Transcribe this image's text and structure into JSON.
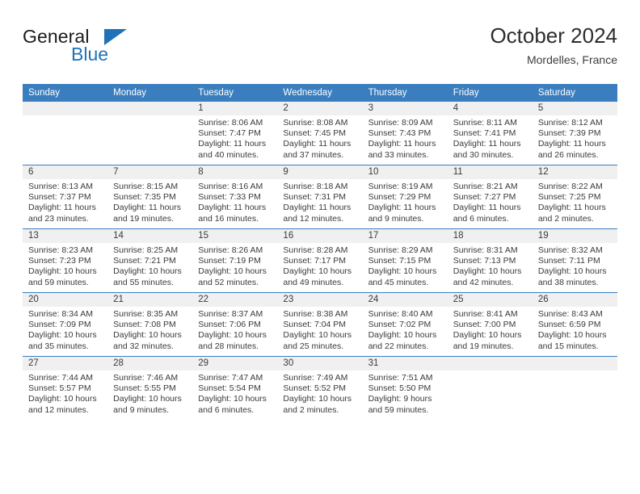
{
  "brand": {
    "name_part1": "General",
    "name_part2": "Blue"
  },
  "header": {
    "title": "October 2024",
    "subtitle": "Mordelles, France"
  },
  "colors": {
    "header_blue": "#3a7ebf",
    "brand_blue": "#1f72b8",
    "daynum_band": "#f0f0f0",
    "text": "#3a3a3a"
  },
  "weekday_headers": [
    "Sunday",
    "Monday",
    "Tuesday",
    "Wednesday",
    "Thursday",
    "Friday",
    "Saturday"
  ],
  "weeks": [
    [
      {
        "day": "",
        "empty": true,
        "sunrise": "",
        "sunset": "",
        "daylight_line1": "",
        "daylight_line2": ""
      },
      {
        "day": "",
        "empty": true,
        "sunrise": "",
        "sunset": "",
        "daylight_line1": "",
        "daylight_line2": ""
      },
      {
        "day": "1",
        "sunrise": "Sunrise: 8:06 AM",
        "sunset": "Sunset: 7:47 PM",
        "daylight_line1": "Daylight: 11 hours",
        "daylight_line2": "and 40 minutes."
      },
      {
        "day": "2",
        "sunrise": "Sunrise: 8:08 AM",
        "sunset": "Sunset: 7:45 PM",
        "daylight_line1": "Daylight: 11 hours",
        "daylight_line2": "and 37 minutes."
      },
      {
        "day": "3",
        "sunrise": "Sunrise: 8:09 AM",
        "sunset": "Sunset: 7:43 PM",
        "daylight_line1": "Daylight: 11 hours",
        "daylight_line2": "and 33 minutes."
      },
      {
        "day": "4",
        "sunrise": "Sunrise: 8:11 AM",
        "sunset": "Sunset: 7:41 PM",
        "daylight_line1": "Daylight: 11 hours",
        "daylight_line2": "and 30 minutes."
      },
      {
        "day": "5",
        "sunrise": "Sunrise: 8:12 AM",
        "sunset": "Sunset: 7:39 PM",
        "daylight_line1": "Daylight: 11 hours",
        "daylight_line2": "and 26 minutes."
      }
    ],
    [
      {
        "day": "6",
        "sunrise": "Sunrise: 8:13 AM",
        "sunset": "Sunset: 7:37 PM",
        "daylight_line1": "Daylight: 11 hours",
        "daylight_line2": "and 23 minutes."
      },
      {
        "day": "7",
        "sunrise": "Sunrise: 8:15 AM",
        "sunset": "Sunset: 7:35 PM",
        "daylight_line1": "Daylight: 11 hours",
        "daylight_line2": "and 19 minutes."
      },
      {
        "day": "8",
        "sunrise": "Sunrise: 8:16 AM",
        "sunset": "Sunset: 7:33 PM",
        "daylight_line1": "Daylight: 11 hours",
        "daylight_line2": "and 16 minutes."
      },
      {
        "day": "9",
        "sunrise": "Sunrise: 8:18 AM",
        "sunset": "Sunset: 7:31 PM",
        "daylight_line1": "Daylight: 11 hours",
        "daylight_line2": "and 12 minutes."
      },
      {
        "day": "10",
        "sunrise": "Sunrise: 8:19 AM",
        "sunset": "Sunset: 7:29 PM",
        "daylight_line1": "Daylight: 11 hours",
        "daylight_line2": "and 9 minutes."
      },
      {
        "day": "11",
        "sunrise": "Sunrise: 8:21 AM",
        "sunset": "Sunset: 7:27 PM",
        "daylight_line1": "Daylight: 11 hours",
        "daylight_line2": "and 6 minutes."
      },
      {
        "day": "12",
        "sunrise": "Sunrise: 8:22 AM",
        "sunset": "Sunset: 7:25 PM",
        "daylight_line1": "Daylight: 11 hours",
        "daylight_line2": "and 2 minutes."
      }
    ],
    [
      {
        "day": "13",
        "sunrise": "Sunrise: 8:23 AM",
        "sunset": "Sunset: 7:23 PM",
        "daylight_line1": "Daylight: 10 hours",
        "daylight_line2": "and 59 minutes."
      },
      {
        "day": "14",
        "sunrise": "Sunrise: 8:25 AM",
        "sunset": "Sunset: 7:21 PM",
        "daylight_line1": "Daylight: 10 hours",
        "daylight_line2": "and 55 minutes."
      },
      {
        "day": "15",
        "sunrise": "Sunrise: 8:26 AM",
        "sunset": "Sunset: 7:19 PM",
        "daylight_line1": "Daylight: 10 hours",
        "daylight_line2": "and 52 minutes."
      },
      {
        "day": "16",
        "sunrise": "Sunrise: 8:28 AM",
        "sunset": "Sunset: 7:17 PM",
        "daylight_line1": "Daylight: 10 hours",
        "daylight_line2": "and 49 minutes."
      },
      {
        "day": "17",
        "sunrise": "Sunrise: 8:29 AM",
        "sunset": "Sunset: 7:15 PM",
        "daylight_line1": "Daylight: 10 hours",
        "daylight_line2": "and 45 minutes."
      },
      {
        "day": "18",
        "sunrise": "Sunrise: 8:31 AM",
        "sunset": "Sunset: 7:13 PM",
        "daylight_line1": "Daylight: 10 hours",
        "daylight_line2": "and 42 minutes."
      },
      {
        "day": "19",
        "sunrise": "Sunrise: 8:32 AM",
        "sunset": "Sunset: 7:11 PM",
        "daylight_line1": "Daylight: 10 hours",
        "daylight_line2": "and 38 minutes."
      }
    ],
    [
      {
        "day": "20",
        "sunrise": "Sunrise: 8:34 AM",
        "sunset": "Sunset: 7:09 PM",
        "daylight_line1": "Daylight: 10 hours",
        "daylight_line2": "and 35 minutes."
      },
      {
        "day": "21",
        "sunrise": "Sunrise: 8:35 AM",
        "sunset": "Sunset: 7:08 PM",
        "daylight_line1": "Daylight: 10 hours",
        "daylight_line2": "and 32 minutes."
      },
      {
        "day": "22",
        "sunrise": "Sunrise: 8:37 AM",
        "sunset": "Sunset: 7:06 PM",
        "daylight_line1": "Daylight: 10 hours",
        "daylight_line2": "and 28 minutes."
      },
      {
        "day": "23",
        "sunrise": "Sunrise: 8:38 AM",
        "sunset": "Sunset: 7:04 PM",
        "daylight_line1": "Daylight: 10 hours",
        "daylight_line2": "and 25 minutes."
      },
      {
        "day": "24",
        "sunrise": "Sunrise: 8:40 AM",
        "sunset": "Sunset: 7:02 PM",
        "daylight_line1": "Daylight: 10 hours",
        "daylight_line2": "and 22 minutes."
      },
      {
        "day": "25",
        "sunrise": "Sunrise: 8:41 AM",
        "sunset": "Sunset: 7:00 PM",
        "daylight_line1": "Daylight: 10 hours",
        "daylight_line2": "and 19 minutes."
      },
      {
        "day": "26",
        "sunrise": "Sunrise: 8:43 AM",
        "sunset": "Sunset: 6:59 PM",
        "daylight_line1": "Daylight: 10 hours",
        "daylight_line2": "and 15 minutes."
      }
    ],
    [
      {
        "day": "27",
        "sunrise": "Sunrise: 7:44 AM",
        "sunset": "Sunset: 5:57 PM",
        "daylight_line1": "Daylight: 10 hours",
        "daylight_line2": "and 12 minutes."
      },
      {
        "day": "28",
        "sunrise": "Sunrise: 7:46 AM",
        "sunset": "Sunset: 5:55 PM",
        "daylight_line1": "Daylight: 10 hours",
        "daylight_line2": "and 9 minutes."
      },
      {
        "day": "29",
        "sunrise": "Sunrise: 7:47 AM",
        "sunset": "Sunset: 5:54 PM",
        "daylight_line1": "Daylight: 10 hours",
        "daylight_line2": "and 6 minutes."
      },
      {
        "day": "30",
        "sunrise": "Sunrise: 7:49 AM",
        "sunset": "Sunset: 5:52 PM",
        "daylight_line1": "Daylight: 10 hours",
        "daylight_line2": "and 2 minutes."
      },
      {
        "day": "31",
        "sunrise": "Sunrise: 7:51 AM",
        "sunset": "Sunset: 5:50 PM",
        "daylight_line1": "Daylight: 9 hours",
        "daylight_line2": "and 59 minutes."
      },
      {
        "day": "",
        "empty": true,
        "sunrise": "",
        "sunset": "",
        "daylight_line1": "",
        "daylight_line2": ""
      },
      {
        "day": "",
        "empty": true,
        "sunrise": "",
        "sunset": "",
        "daylight_line1": "",
        "daylight_line2": ""
      }
    ]
  ]
}
